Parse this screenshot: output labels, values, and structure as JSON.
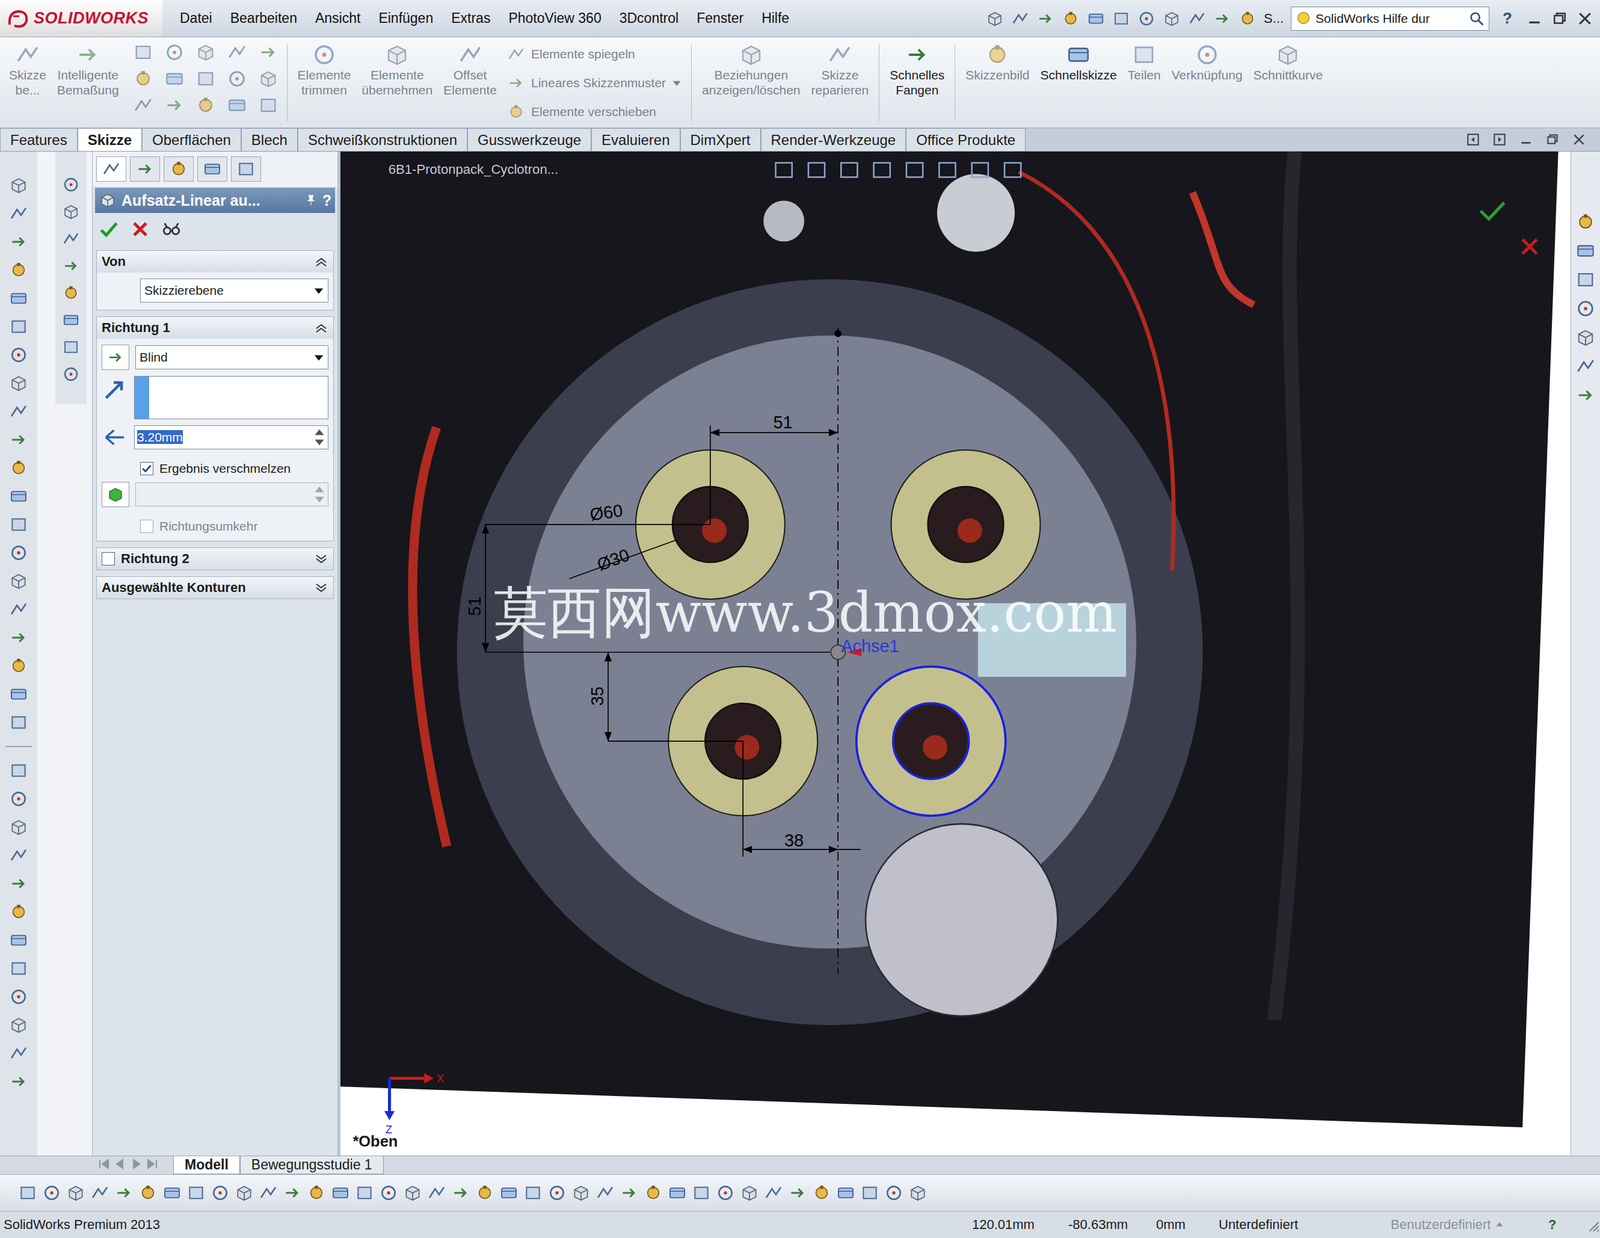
{
  "window": {
    "logo": "SOLIDWORKS"
  },
  "menu": [
    "Datei",
    "Bearbeiten",
    "Ansicht",
    "Einfügen",
    "Extras",
    "PhotoView 360",
    "3Dcontrol",
    "Fenster",
    "Hilfe"
  ],
  "menu_bar": {
    "overflow": "S...",
    "search": "SolidWorks Hilfe dur",
    "help": "?"
  },
  "command_manager": {
    "sketch": [
      {
        "lines": [
          "Skizze",
          "be..."
        ],
        "disabled": true
      },
      {
        "lines": [
          "Intelligente",
          "Bemaßung"
        ],
        "disabled": true
      }
    ],
    "edit": [
      {
        "lines": [
          "Elemente",
          "trimmen"
        ],
        "disabled": true
      },
      {
        "lines": [
          "Elemente",
          "übernehmen"
        ],
        "disabled": true
      },
      {
        "lines": [
          "Offset",
          "Elemente"
        ],
        "disabled": true
      }
    ],
    "stack": [
      {
        "label": "Elemente spiegeln",
        "disabled": true
      },
      {
        "label": "Lineares Skizzenmuster",
        "disabled": true
      },
      {
        "label": "Elemente verschieben",
        "disabled": true
      }
    ],
    "tools": [
      {
        "lines": [
          "Beziehungen",
          "anzeigen/löschen"
        ],
        "disabled": true
      },
      {
        "lines": [
          "Skizze",
          "reparieren"
        ],
        "disabled": true
      },
      {
        "lines": [
          "Schnelles",
          "Fangen"
        ],
        "disabled": false
      },
      {
        "lines": [
          "Skizzenbild"
        ],
        "disabled": true
      },
      {
        "lines": [
          "Schnellskizze"
        ],
        "disabled": false
      },
      {
        "lines": [
          "Teilen"
        ],
        "disabled": true
      },
      {
        "lines": [
          "Verknüpfung"
        ],
        "disabled": true
      },
      {
        "lines": [
          "Schnittkurve"
        ],
        "disabled": true
      }
    ]
  },
  "tabs": [
    {
      "label": "Features",
      "selected": false
    },
    {
      "label": "Skizze",
      "selected": true
    },
    {
      "label": "Oberflächen",
      "selected": false
    },
    {
      "label": "Blech",
      "selected": false
    },
    {
      "label": "Schweißkonstruktionen",
      "selected": false
    },
    {
      "label": "Gusswerkzeuge",
      "selected": false
    },
    {
      "label": "Evaluieren",
      "selected": false
    },
    {
      "label": "DimXpert",
      "selected": false
    },
    {
      "label": "Render-Werkzeuge",
      "selected": false
    },
    {
      "label": "Office Produkte",
      "selected": false
    }
  ],
  "property_manager": {
    "title": "Aufsatz-Linear au...",
    "help": "?",
    "from": {
      "title": "Von",
      "expanded": true,
      "start": "Skizzierebene"
    },
    "direction1": {
      "title": "Richtung 1",
      "expanded": true,
      "end_condition": "Blind",
      "depth": "3.20mm",
      "depth_selected": true,
      "merge": {
        "label": "Ergebnis verschmelzen",
        "checked": true
      },
      "reverse": {
        "label": "Richtungsumkehr",
        "checked": false,
        "disabled": true
      }
    },
    "direction2": {
      "title": "Richtung 2",
      "enabled": false,
      "expanded": false
    },
    "contours": {
      "title": "Ausgewählte Konturen",
      "expanded": false
    }
  },
  "graphics": {
    "document": "6B1-Protonpack_Cyclotron...",
    "watermark": "莫西网www.3dmox.com",
    "axis": "Achse1",
    "view": "*Oben",
    "triad": [
      "X",
      "Z"
    ],
    "circles": [
      {
        "selected": false
      },
      {
        "selected": false
      },
      {
        "selected": false
      },
      {
        "selected": true
      }
    ],
    "dimensions": [
      "51",
      "Ø60",
      "Ø30",
      "51",
      "35",
      "38"
    ]
  },
  "bottom_tabs": [
    {
      "label": "Modell",
      "selected": true
    },
    {
      "label": "Bewegungsstudie 1",
      "selected": false
    }
  ],
  "status_bar": {
    "product": "SolidWorks Premium 2013",
    "x": "120.01mm",
    "y": "-80.63mm",
    "z": "0mm",
    "state": "Unterdefiniert",
    "units": "Benutzerdefiniert",
    "help": "?"
  }
}
